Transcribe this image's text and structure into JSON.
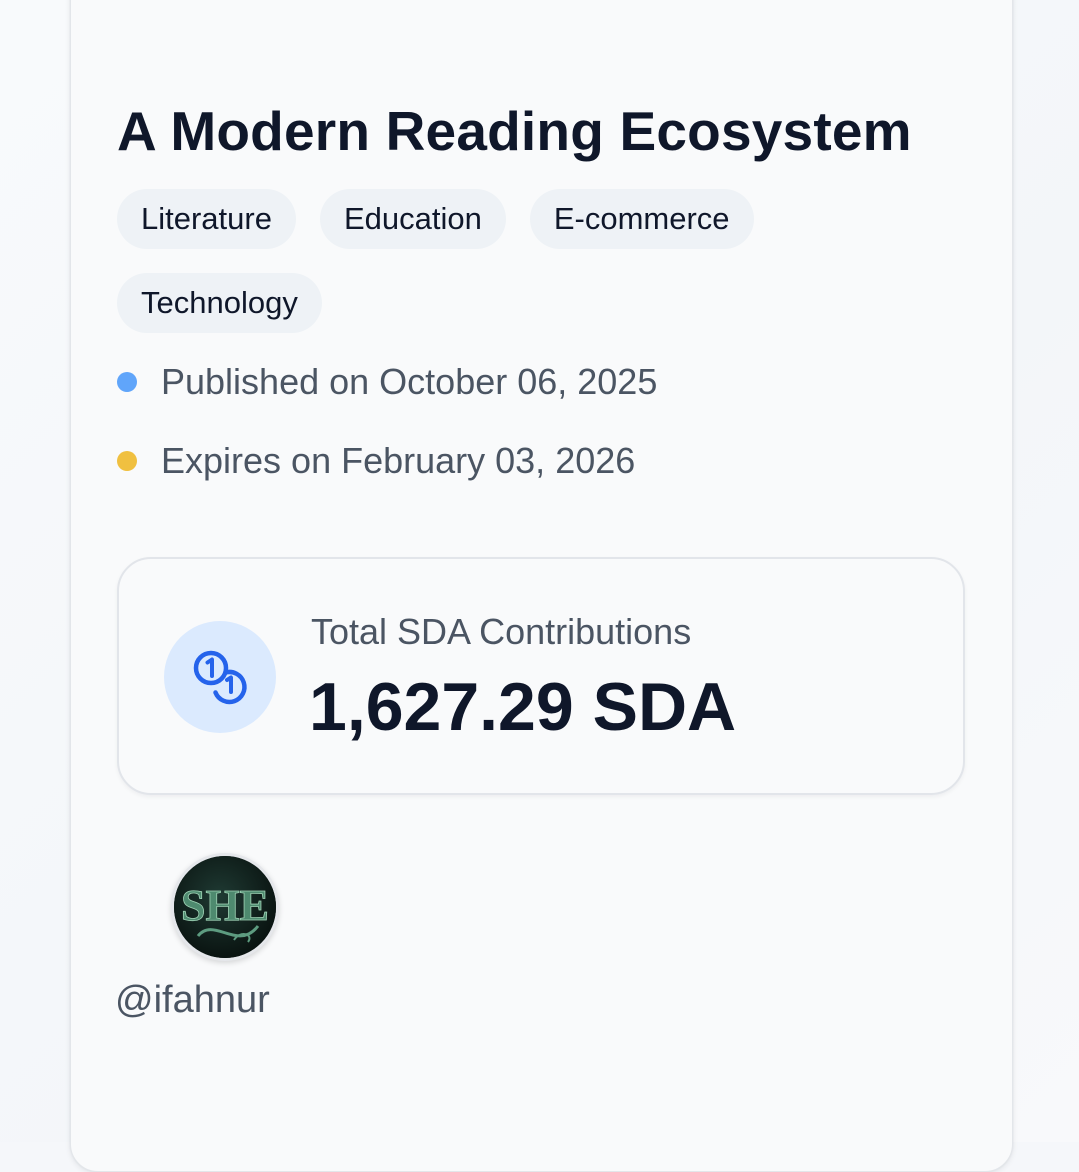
{
  "campaign": {
    "title": "A Modern Reading Ecosystem",
    "tags": [
      "Literature",
      "Education",
      "E-commerce",
      "Technology"
    ],
    "published": {
      "text": "Published on October 06, 2025",
      "dot_color": "#60a5fa"
    },
    "expires": {
      "text": "Expires on February 03, 2026",
      "dot_color": "#f0c040"
    }
  },
  "contributions": {
    "label": "Total SDA Contributions",
    "value": "1,627.29 SDA",
    "icon": "coins-icon",
    "accent_color": "#2563eb"
  },
  "author": {
    "username": "@ifahnur",
    "avatar_icon": "she-logo-avatar"
  }
}
